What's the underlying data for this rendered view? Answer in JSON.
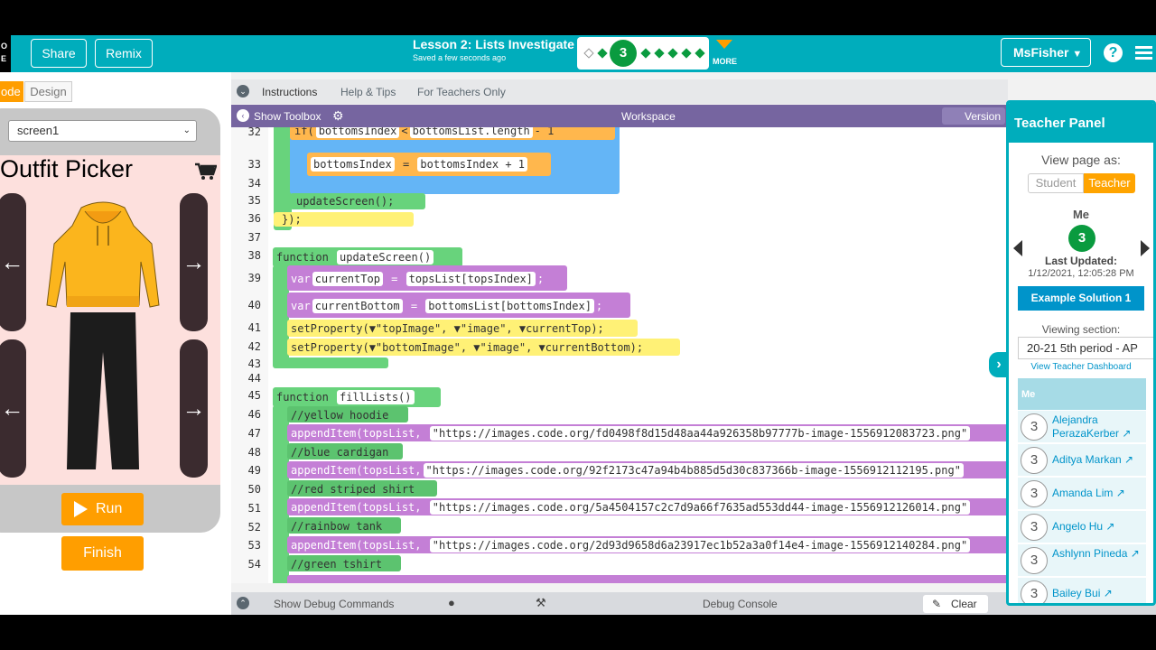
{
  "header": {
    "logo_text": "O\nE",
    "share_label": "Share",
    "remix_label": "Remix",
    "lesson_title": "Lesson 2: Lists Investigate",
    "saved_status": "Saved a few seconds ago",
    "current_level": "3",
    "more_label": "MORE",
    "user_label": "MsFisher",
    "help_label": "?"
  },
  "left": {
    "code_tab": "ode",
    "design_tab": "Design",
    "screen_select": "screen1",
    "app_title": "Outfit Picker",
    "arrow_left": "←",
    "arrow_right": "→",
    "run_label": "Run",
    "finish_label": "Finish"
  },
  "instructions": {
    "tab_instructions": "Instructions",
    "tab_help": "Help & Tips",
    "tab_teachers": "For Teachers Only"
  },
  "workspace": {
    "show_toolbox": "Show Toolbox",
    "title": "Workspace",
    "version": "Version"
  },
  "code": {
    "lines": [
      "32",
      "33",
      "34",
      "35",
      "36",
      "37",
      "38",
      "39",
      "40",
      "41",
      "42",
      "43",
      "44",
      "45",
      "46",
      "47",
      "48",
      "49",
      "50",
      "51",
      "52",
      "53",
      "54"
    ],
    "l32_if": "if(",
    "l32_a": "bottomsIndex",
    "l32_op": "<",
    "l32_b": "bottomsList.length",
    "l32_c": "- 1",
    "l33_var": "bottomsIndex",
    "l33_eq": "=",
    "l33_val": "bottomsIndex + 1",
    "l35": "updateScreen();",
    "l36": "});",
    "l38_fn": "function",
    "l38_name": "updateScreen()",
    "l39_var": "var",
    "l39_name": "currentTop",
    "l39_val": "topsList[topsIndex]",
    "l40_var": "var",
    "l40_name": "currentBottom",
    "l40_val": "bottomsList[bottomsIndex]",
    "l41": "setProperty(▼\"topImage\", ▼\"image\", ▼currentTop);",
    "l42": "setProperty(▼\"bottomImage\", ▼\"image\", ▼currentBottom);",
    "l45_fn": "function",
    "l45_name": "fillLists()",
    "l46": "//yellow hoodie",
    "l47_call": "appendItem(",
    "l47_list": "topsList,",
    "l47_url": "\"https://images.code.org/fd0498f8d15d48aa44a926358b97777b-image-1556912083723.png\"",
    "l48": "//blue cardigan",
    "l49_url": "\"https://images.code.org/92f2173c47a94b4b885d5d30c837366b-image-1556912112195.png\"",
    "l50": "//red striped shirt",
    "l51_url": "\"https://images.code.org/5a4504157c2c7d9a66f7635ad553dd44-image-1556912126014.png\"",
    "l52": "//rainbow tank",
    "l53_url": "\"https://images.code.org/2d93d9658d6a23917ec1b52a3a0f14e4-image-1556912140284.png\"",
    "l54": "//green tshirt"
  },
  "debug": {
    "show_debug": "Show Debug Commands",
    "console": "Debug Console",
    "clear": "Clear"
  },
  "teacher_panel": {
    "title": "Teacher Panel",
    "view_as": "View page as:",
    "student": "Student",
    "teacher": "Teacher",
    "me_label": "Me",
    "me_level": "3",
    "last_updated_label": "Last Updated:",
    "last_updated_value": "1/12/2021, 12:05:28 PM",
    "example_solution": "Example Solution 1",
    "viewing_section": "Viewing section:",
    "section_value": "20-21 5th period - AP",
    "dashboard_link": "View Teacher Dashboard",
    "list_header": "Me",
    "students": [
      {
        "num": "3",
        "name": "Alejandra PerazaKerber"
      },
      {
        "num": "3",
        "name": "Aditya Markan"
      },
      {
        "num": "3",
        "name": "Amanda Lim"
      },
      {
        "num": "3",
        "name": "Angelo Hu"
      },
      {
        "num": "3",
        "name": "Ashlynn Pineda"
      },
      {
        "num": "3",
        "name": "Bailey Bui"
      }
    ]
  },
  "colors": {
    "teal": "#00adbc",
    "orange": "#ff9e00",
    "green": "#0a9b3f",
    "purple": "#7665a0"
  }
}
